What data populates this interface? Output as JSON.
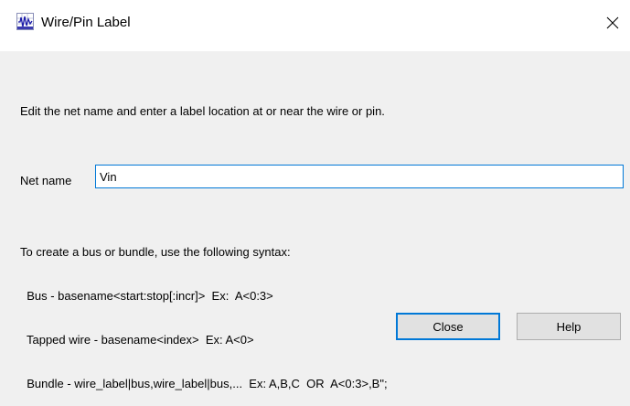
{
  "window": {
    "title": "Wire/Pin Label",
    "close_glyph": "✕"
  },
  "instruction": "Edit the net name and enter a label location at or near the wire or pin.",
  "net_name": {
    "label": "Net name",
    "value": "Vin"
  },
  "syntax_help": {
    "heading": "To create a bus or bundle, use the following syntax:",
    "lines": [
      "  Bus - basename<start:stop[:incr]>  Ex:  A<0:3>",
      "  Tapped wire - basename<index>  Ex: A<0>",
      "  Bundle - wire_label|bus,wire_label|bus,...  Ex: A,B,C  OR  A<0:3>,B\";"
    ]
  },
  "buttons": {
    "close": "Close",
    "help": "Help"
  },
  "colors": {
    "accent": "#0078d7",
    "dialog_bg": "#f0f0f0",
    "titlebar_bg": "#ffffff",
    "button_bg": "#e1e1e1"
  },
  "icons": {
    "app": "waveform-app-icon",
    "close": "close-icon"
  }
}
